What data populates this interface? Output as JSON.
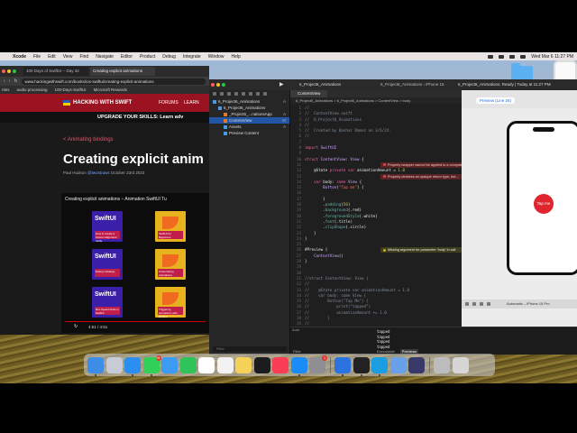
{
  "menubar": {
    "app": "Xcode",
    "items": [
      "File",
      "Edit",
      "View",
      "Find",
      "Navigate",
      "Editor",
      "Product",
      "Debug",
      "Integrate",
      "Window",
      "Help"
    ],
    "clock": "Wed Mar 6  11:27 PM"
  },
  "browser": {
    "tabs": [
      "100 Days of SwiftUI – Day 32",
      "Creating explicit animations"
    ],
    "url": "www.hackingwithswift.com/books/ios-swiftui/creating-explicit-animations",
    "bookmarks": [
      "rties",
      "audio processing",
      "100-Days-SwiftUI",
      "Microsoft Rewards"
    ],
    "site_name": "HACKING WITH SWIFT",
    "site_nav": [
      "FORUMS",
      "LEARN"
    ],
    "upgrade_banner": "UPGRADE YOUR SKILLS: Learn adv",
    "breadcrumb": "< Animating bindings",
    "article_title": "Creating explicit anim",
    "author": "Paul Hudson",
    "handle": "@twostraws",
    "date": "October 23rd 2023",
    "video_title": "Creating explicit animations – Animation SwiftUI Tu",
    "thumb_label": "SwiftUI",
    "thumb_captions": [
      "How to create a custom alignment guide",
      "SwiftUI for Beginners",
      "Dating Catalogs",
      "Customizing Animations",
      "Rex Speed tricks in SwiftUI",
      "Triggering animations with binding"
    ],
    "video_time": "4:51 / 4:51"
  },
  "xcode": {
    "scheme": "6_Project6_Animations",
    "destination_crumbs": [
      "6_Project6_Animations",
      "iPhone 15"
    ],
    "status": "6_Project6_Animations: Ready | Today at 11:27 PM",
    "nav_items": [
      {
        "label": "6_Project6_Animations",
        "flag": "A"
      },
      {
        "label": "6_Project6_Animations",
        "flag": ""
      },
      {
        "label": "_Project6_...nationsApp",
        "flag": "A"
      },
      {
        "label": "ContentView",
        "flag": "M"
      },
      {
        "label": "Assets",
        "flag": "A"
      },
      {
        "label": "Preview Content",
        "flag": ""
      }
    ],
    "nav_filter": "Filter",
    "editor_tab": "ContentView",
    "jumpbar": "6_Project6_Animations  >  6_Project6_Animations  >  ContentView  >  body",
    "code": [
      "//",
      "//  ContentView.swift",
      "//  6_Project6_Animations",
      "//",
      "//  Created by Bashar Ramez on 3/6/24.",
      "//",
      "",
      "import SwiftUI",
      "",
      "struct ContentView: View {",
      "",
      "    @State private var animationAmount = 1.0",
      "",
      "    var body: some View {",
      "        Button(\"Tap me\") {",
      "",
      "        }",
      "        .padding(50)",
      "        .background(.red)",
      "        .foregroundStyle(.white)",
      "        .font(.title)",
      "        .clipShape(.circle)",
      "    }",
      "}",
      "",
      "#Preview {",
      "    ContentView()",
      "}",
      "",
      "",
      "//struct ContentView: View {",
      "//",
      "//    @State private var animationAmount = 1.0",
      "//    var body: some View {",
      "//        Button(\"Tap Me\") {",
      "//            print(\"tapped\")",
      "//            animationAmount += 1.0",
      "//        }",
      "//"
    ],
    "errors": [
      {
        "text": "Property wrapper cannot be applied to a computed pro",
        "kind": "err"
      },
      {
        "text": "Property declares an opaque return type, but...",
        "kind": "err"
      },
      {
        "text": "Missing argument for parameter 'body' in call",
        "kind": "warn"
      }
    ],
    "preview_label": "Preview (Line 26)",
    "phone_button": "Tap me",
    "device": "Automatic – iPhone 15 Pro",
    "console_lines": [
      "tapped",
      "tapped",
      "tapped",
      "tapped",
      "tapped",
      "tapped"
    ],
    "console_tabs": [
      "Executable",
      "Previews"
    ],
    "line_col": "Auto",
    "debug_filter": "Filter"
  },
  "dock": {
    "apps": [
      {
        "name": "finder-icon",
        "color": "#3b8de8"
      },
      {
        "name": "launchpad-icon",
        "color": "#c8cbd6"
      },
      {
        "name": "safari-icon",
        "color": "#2a8ff0"
      },
      {
        "name": "messages-icon",
        "color": "#2fd158",
        "badge": "94"
      },
      {
        "name": "mail-icon",
        "color": "#3c9cf3"
      },
      {
        "name": "facetime-icon",
        "color": "#2ec45a"
      },
      {
        "name": "calendar-icon",
        "color": "#ffffff"
      },
      {
        "name": "reminders-icon",
        "color": "#f2f2f2"
      },
      {
        "name": "notes-icon",
        "color": "#f5d15a"
      },
      {
        "name": "tv-icon",
        "color": "#1c1c1e"
      },
      {
        "name": "music-icon",
        "color": "#fa3c55"
      },
      {
        "name": "app-store-icon",
        "color": "#1a8cf5"
      },
      {
        "name": "system-settings-icon",
        "color": "#8e8e93",
        "badge": "1"
      },
      {
        "name": "xcode-icon",
        "color": "#2b73e0"
      },
      {
        "name": "terminal-icon",
        "color": "#222222"
      },
      {
        "name": "edge-icon",
        "color": "#1b9de2"
      },
      {
        "name": "preview-icon",
        "color": "#6aa0e8"
      },
      {
        "name": "instruments-icon",
        "color": "#3a3a6a"
      },
      {
        "name": "disk-utility-icon",
        "color": "#bcbcbc"
      },
      {
        "name": "trash-icon",
        "color": "#d6d6d6"
      }
    ]
  }
}
